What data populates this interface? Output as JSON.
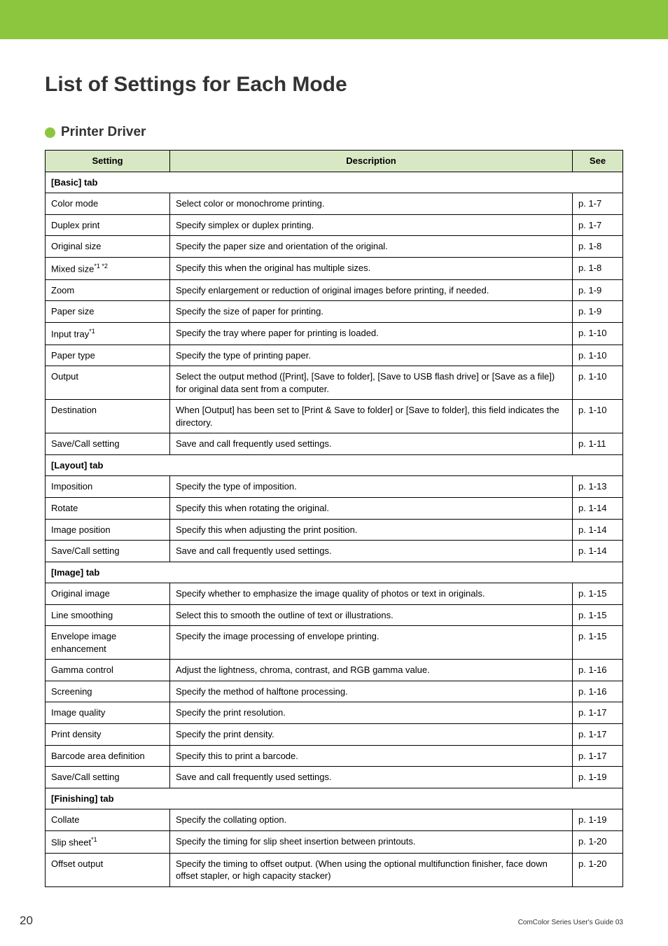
{
  "title": "List of Settings for Each Mode",
  "section": "Printer Driver",
  "headers": {
    "setting": "Setting",
    "description": "Description",
    "see": "See"
  },
  "page_number": "20",
  "footer": "ComColor Series User's Guide 03",
  "groups": [
    {
      "label": "[Basic] tab",
      "rows": [
        {
          "setting": "Color mode",
          "desc": "Select color or monochrome printing.",
          "see": "p. 1-7"
        },
        {
          "setting": "Duplex print",
          "desc": "Specify simplex or duplex printing.",
          "see": "p. 1-7"
        },
        {
          "setting": "Original size",
          "desc": "Specify the paper size and orientation of the original.",
          "see": "p. 1-8"
        },
        {
          "setting": "Mixed size",
          "sup": "*1 *2",
          "desc": "Specify this when the original has multiple sizes.",
          "see": "p. 1-8"
        },
        {
          "setting": "Zoom",
          "desc": "Specify enlargement or reduction of original images before printing, if needed.",
          "see": "p. 1-9"
        },
        {
          "setting": "Paper size",
          "desc": "Specify the size of paper for printing.",
          "see": "p. 1-9"
        },
        {
          "setting": "Input tray",
          "sup": "*1",
          "desc": "Specify the tray where paper for printing is loaded.",
          "see": "p. 1-10"
        },
        {
          "setting": "Paper type",
          "desc": "Specify the type of printing paper.",
          "see": "p. 1-10"
        },
        {
          "setting": "Output",
          "desc": "Select the output method ([Print], [Save to folder], [Save to USB flash drive] or [Save as a file]) for original data sent from a computer.",
          "see": "p. 1-10"
        },
        {
          "setting": "Destination",
          "desc": "When [Output] has been set to [Print & Save to folder] or [Save to folder], this field indicates the directory.",
          "see": "p. 1-10"
        },
        {
          "setting": "Save/Call setting",
          "desc": "Save and call frequently used settings.",
          "see": "p. 1-11"
        }
      ]
    },
    {
      "label": "[Layout] tab",
      "rows": [
        {
          "setting": "Imposition",
          "desc": "Specify the type of imposition.",
          "see": "p. 1-13"
        },
        {
          "setting": "Rotate",
          "desc": "Specify this when rotating the original.",
          "see": "p. 1-14"
        },
        {
          "setting": "Image position",
          "desc": "Specify this when adjusting the print position.",
          "see": "p. 1-14"
        },
        {
          "setting": "Save/Call setting",
          "desc": "Save and call frequently used settings.",
          "see": "p. 1-14"
        }
      ]
    },
    {
      "label": "[Image] tab",
      "rows": [
        {
          "setting": "Original image",
          "desc": "Specify whether to emphasize the image quality of photos or text in originals.",
          "see": "p. 1-15"
        },
        {
          "setting": "Line smoothing",
          "desc": "Select this to smooth the outline of text or illustrations.",
          "see": "p. 1-15"
        },
        {
          "setting": "Envelope image enhancement",
          "desc": "Specify the image processing of envelope printing.",
          "see": "p. 1-15"
        },
        {
          "setting": "Gamma control",
          "desc": "Adjust the lightness, chroma, contrast, and RGB gamma value.",
          "see": "p. 1-16"
        },
        {
          "setting": "Screening",
          "desc": "Specify the method of halftone processing.",
          "see": "p. 1-16"
        },
        {
          "setting": "Image quality",
          "desc": "Specify the print resolution.",
          "see": "p. 1-17"
        },
        {
          "setting": "Print density",
          "desc": "Specify the print density.",
          "see": "p. 1-17"
        },
        {
          "setting": "Barcode area definition",
          "desc": "Specify this to print a barcode.",
          "see": "p. 1-17"
        },
        {
          "setting": "Save/Call setting",
          "desc": "Save and call frequently used settings.",
          "see": "p. 1-19"
        }
      ]
    },
    {
      "label": "[Finishing] tab",
      "rows": [
        {
          "setting": "Collate",
          "desc": "Specify the collating option.",
          "see": "p. 1-19"
        },
        {
          "setting": "Slip sheet",
          "sup": "*1",
          "desc": "Specify the timing for slip sheet insertion between printouts.",
          "see": "p. 1-20"
        },
        {
          "setting": "Offset output",
          "desc": "Specify the timing to offset output. (When using the optional multifunction finisher, face down offset stapler, or high capacity stacker)",
          "see": "p. 1-20"
        }
      ]
    }
  ]
}
